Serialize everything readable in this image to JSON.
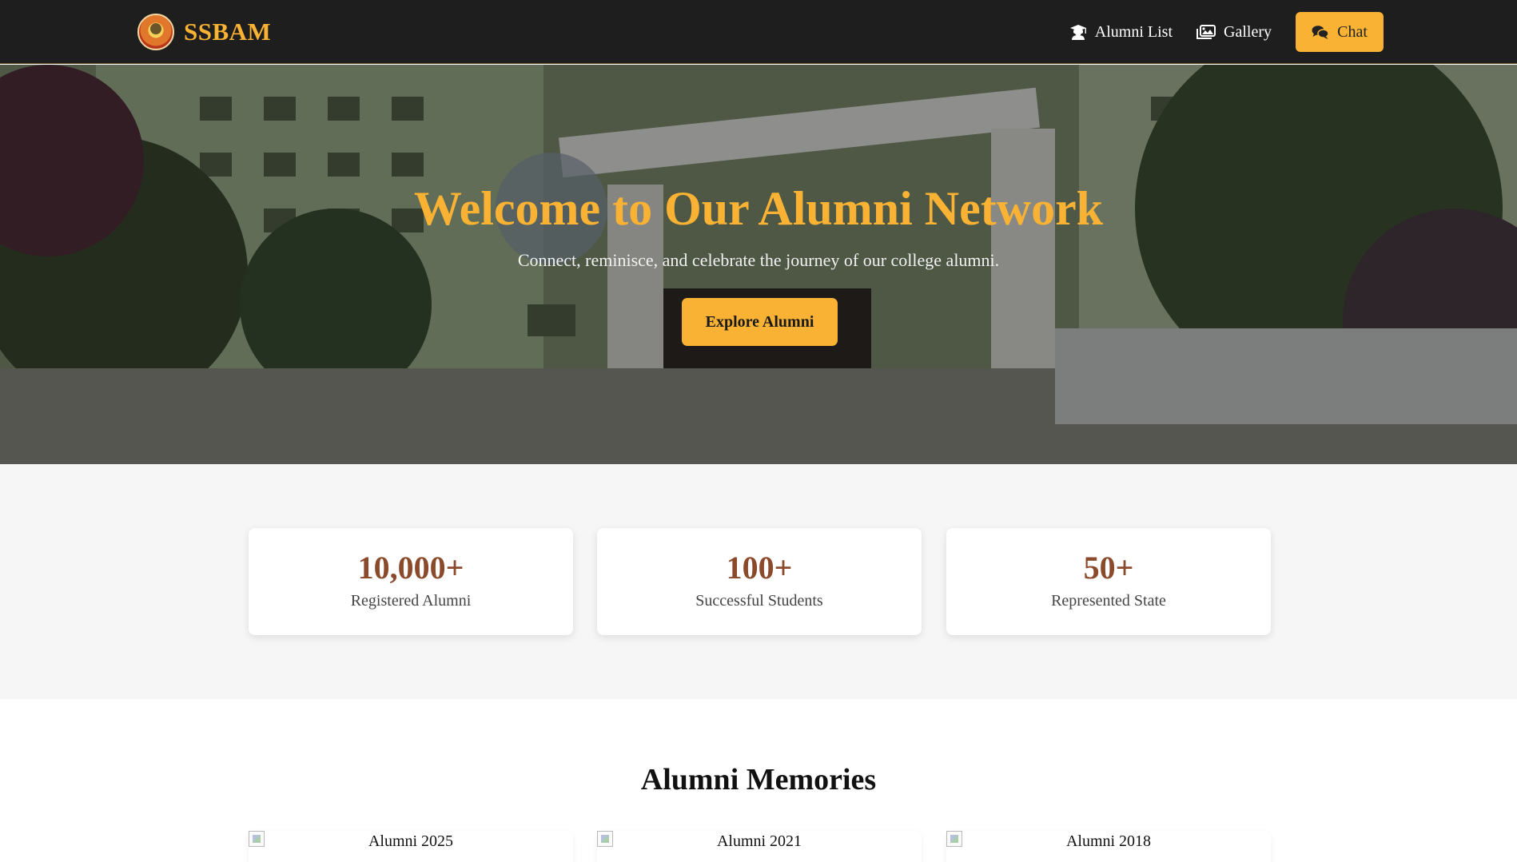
{
  "navbar": {
    "brand": "SSBAM",
    "links": [
      {
        "label": "Alumni List",
        "icon": "graduate-icon"
      },
      {
        "label": "Gallery",
        "icon": "images-icon"
      }
    ],
    "chat": {
      "label": "Chat",
      "icon": "chat-bubbles-icon"
    }
  },
  "hero": {
    "title": "Welcome to Our Alumni Network",
    "subtitle": "Connect, reminisce, and celebrate the journey of our college alumni.",
    "cta": "Explore Alumni"
  },
  "stats": [
    {
      "value": "10,000+",
      "label": "Registered Alumni"
    },
    {
      "value": "100+",
      "label": "Successful Students"
    },
    {
      "value": "50+",
      "label": "Represented State"
    }
  ],
  "memories": {
    "title": "Alumni Memories",
    "items": [
      {
        "caption": "Alumni 2025"
      },
      {
        "caption": "Alumni 2021"
      },
      {
        "caption": "Alumni 2018"
      }
    ]
  },
  "colors": {
    "accent": "#f9b233",
    "navbar_bg": "#1e1e1e",
    "stat_number": "#8b4a2b",
    "stats_bg": "#f6f6f6"
  }
}
